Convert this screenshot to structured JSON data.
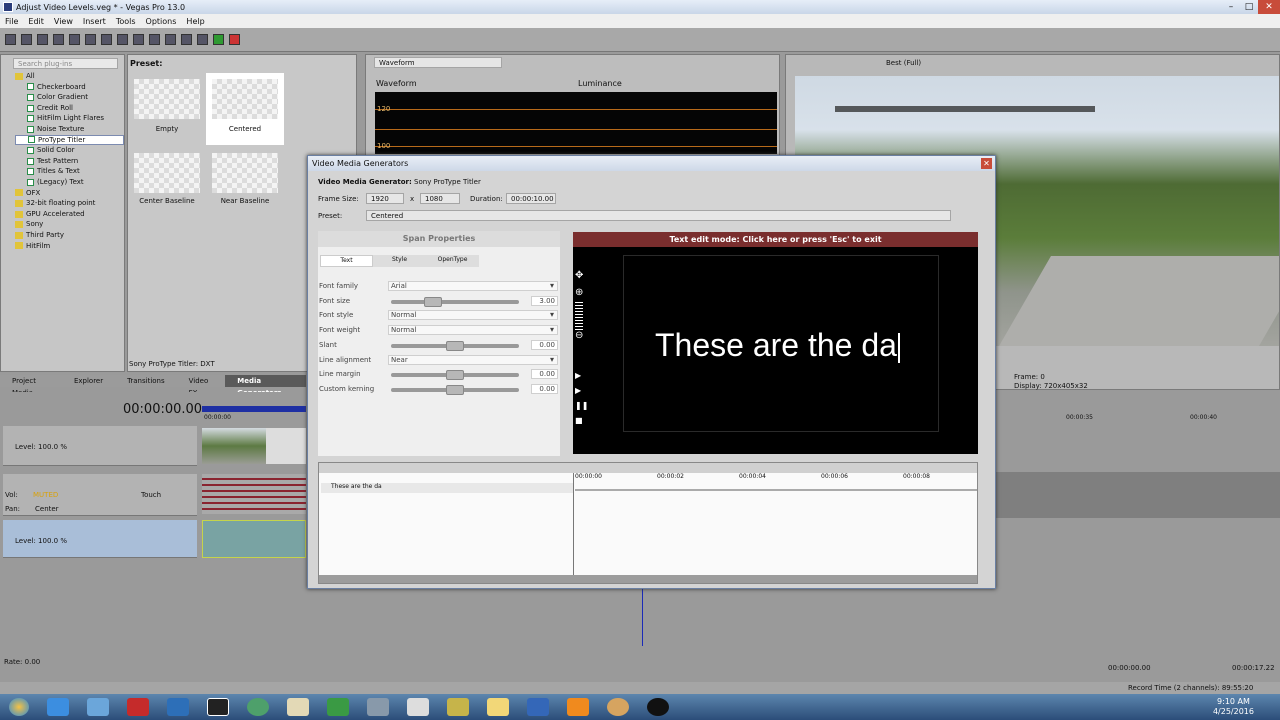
{
  "window": {
    "title": "Adjust Video Levels.veg * - Vegas Pro 13.0"
  },
  "menu": [
    "File",
    "Edit",
    "View",
    "Insert",
    "Tools",
    "Options",
    "Help"
  ],
  "plugins": {
    "search_placeholder": "Search plug-ins",
    "tree": [
      {
        "label": "All",
        "level": 1,
        "type": "folder"
      },
      {
        "label": "Checkerboard",
        "level": 2,
        "type": "file"
      },
      {
        "label": "Color Gradient",
        "level": 2,
        "type": "file"
      },
      {
        "label": "Credit Roll",
        "level": 2,
        "type": "file"
      },
      {
        "label": "HitFilm Light Flares",
        "level": 2,
        "type": "file"
      },
      {
        "label": "Noise Texture",
        "level": 2,
        "type": "file"
      },
      {
        "label": "ProType Titler",
        "level": 2,
        "type": "file",
        "selected": true
      },
      {
        "label": "Solid Color",
        "level": 2,
        "type": "file"
      },
      {
        "label": "Test Pattern",
        "level": 2,
        "type": "file"
      },
      {
        "label": "Titles & Text",
        "level": 2,
        "type": "file"
      },
      {
        "label": "(Legacy) Text",
        "level": 2,
        "type": "file"
      },
      {
        "label": "OFX",
        "level": 1,
        "type": "folder"
      },
      {
        "label": "32-bit floating point",
        "level": 1,
        "type": "folder"
      },
      {
        "label": "GPU Accelerated",
        "level": 1,
        "type": "folder"
      },
      {
        "label": "Sony",
        "level": 1,
        "type": "folder"
      },
      {
        "label": "Third Party",
        "level": 1,
        "type": "folder"
      },
      {
        "label": "HitFilm",
        "level": 1,
        "type": "folder"
      }
    ]
  },
  "preset_panel": {
    "label": "Preset:",
    "items": [
      "Empty",
      "Centered",
      "Center Baseline",
      "Near Baseline"
    ],
    "footer": "Sony ProType Titler: DXT"
  },
  "bottom_tabs": [
    "Project Media",
    "Explorer",
    "Transitions",
    "Video FX",
    "Media Generators"
  ],
  "scope": {
    "mode": "Waveform",
    "header": "Waveform",
    "channel": "Luminance",
    "ticks": [
      "120",
      "100"
    ]
  },
  "preview": {
    "quality": "Best (Full)",
    "frame_label": "Frame:",
    "frame": "0",
    "display_label": "Display:",
    "display": "720x405x32"
  },
  "timeline": {
    "timecode": "00:00:00.00",
    "ruler": [
      "00:00:00",
      "00:00:35",
      "00:00:40"
    ],
    "track1": {
      "level": "Level: 100.0 %"
    },
    "track2": {
      "vol": "Vol:",
      "vol_val": "MUTED",
      "touch": "Touch",
      "pan": "Pan:",
      "pan_val": "Center"
    },
    "track3": {
      "level": "Level: 100.0 %"
    },
    "rate": "Rate: 0.00",
    "end_time": "00:00:00.00",
    "end_time2": "00:00:17.22",
    "record": "Record Time (2 channels): 89:55:20"
  },
  "dialog": {
    "title": "Video Media Generators",
    "generator_label": "Video Media Generator:",
    "generator": "Sony ProType Titler",
    "frame_size_label": "Frame Size:",
    "width": "1920",
    "x": "x",
    "height": "1080",
    "duration_label": "Duration:",
    "duration": "00:00:10.00",
    "preset_label": "Preset:",
    "preset": "Centered",
    "span_title": "Span Properties",
    "tabs": [
      "Text",
      "Style",
      "OpenType"
    ],
    "props": [
      {
        "label": "Font family",
        "kind": "dropdown",
        "value": "Arial"
      },
      {
        "label": "Font size",
        "kind": "slider",
        "value": "3.00",
        "pos": 0.3
      },
      {
        "label": "Font style",
        "kind": "dropdown",
        "value": "Normal"
      },
      {
        "label": "Font weight",
        "kind": "dropdown",
        "value": "Normal"
      },
      {
        "label": "Slant",
        "kind": "slider",
        "value": "0.00",
        "pos": 0.5
      },
      {
        "label": "Line alignment",
        "kind": "dropdown",
        "value": "Near"
      },
      {
        "label": "Line margin",
        "kind": "slider",
        "value": "0.00",
        "pos": 0.5
      },
      {
        "label": "Custom kerning",
        "kind": "slider",
        "value": "0.00",
        "pos": 0.5
      }
    ],
    "edit_mode": "Text edit mode: Click here or press 'Esc' to exit",
    "canvas_text": "These are the da",
    "kf_ruler": [
      "00:00:00",
      "00:00:02",
      "00:00:04",
      "00:00:06",
      "00:00:08"
    ],
    "kf_item": "These are the da"
  },
  "clock": {
    "time": "9:10 AM",
    "date": "4/25/2016"
  }
}
